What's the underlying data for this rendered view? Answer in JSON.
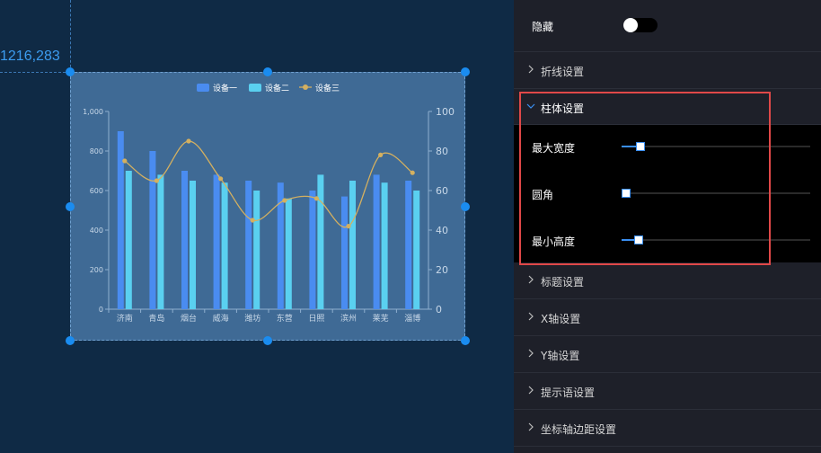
{
  "canvas": {
    "coord_label": "1216,283"
  },
  "chart_data": {
    "type": "bar",
    "categories": [
      "济南",
      "青岛",
      "烟台",
      "威海",
      "潍坊",
      "东营",
      "日照",
      "滨州",
      "莱芜",
      "淄博"
    ],
    "series": [
      {
        "name": "设备一",
        "type": "bar",
        "axis": "left",
        "color": "#4a8cf0",
        "values": [
          900,
          800,
          700,
          680,
          650,
          640,
          600,
          570,
          680,
          650
        ]
      },
      {
        "name": "设备二",
        "type": "bar",
        "axis": "left",
        "color": "#5ad0f0",
        "values": [
          700,
          680,
          650,
          640,
          600,
          560,
          680,
          650,
          640,
          600
        ]
      },
      {
        "name": "设备三",
        "type": "line",
        "axis": "right",
        "smooth": true,
        "color": "#d4b060",
        "values": [
          75,
          65,
          85,
          66,
          45,
          55,
          56,
          42,
          78,
          69
        ]
      }
    ],
    "y_left": {
      "ticks": [
        "0",
        "200",
        "400",
        "600",
        "800",
        "1,000"
      ],
      "min": 0,
      "max": 1000
    },
    "y_right": {
      "ticks": [
        "0",
        "20",
        "40",
        "60",
        "80",
        "100"
      ],
      "min": 0,
      "max": 100
    },
    "legend": "top-center",
    "grid": false
  },
  "panel": {
    "hide_label": "隐藏",
    "hide_on": false,
    "sections_top": [
      {
        "label": "折线设置",
        "expanded": false
      }
    ],
    "bar_section": {
      "label": "柱体设置",
      "expanded": true,
      "sliders": [
        {
          "label": "最大宽度",
          "value": 0.1
        },
        {
          "label": "圆角",
          "value": 0
        },
        {
          "label": "最小高度",
          "value": 0.09
        }
      ]
    },
    "sections_bottom": [
      {
        "label": "标题设置"
      },
      {
        "label": "X轴设置"
      },
      {
        "label": "Y轴设置"
      },
      {
        "label": "提示语设置"
      },
      {
        "label": "坐标轴边距设置"
      }
    ]
  },
  "colors": {
    "canvas_bg": "#0f2a45",
    "panel_bg": "#1e2029",
    "accent": "#3a8ef0",
    "highlight": "#e04848"
  }
}
